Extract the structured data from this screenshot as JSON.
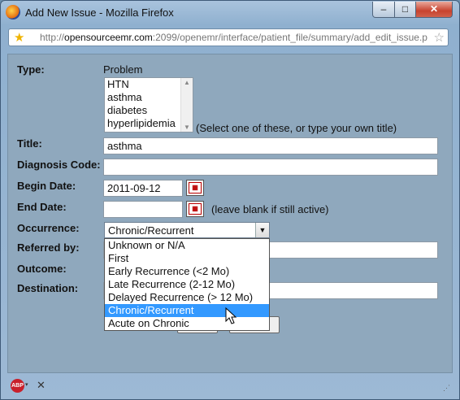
{
  "window": {
    "title": "Add New Issue - Mozilla Firefox",
    "buttons": {
      "minimize": "–",
      "maximize": "□",
      "close": "✕"
    }
  },
  "urlbar": {
    "prefix": "http://",
    "host": "opensourceemr.com",
    "rest": ":2099/openemr/interface/patient_file/summary/add_edit_issue.p"
  },
  "form": {
    "type_label": "Type:",
    "type_value": "Problem",
    "type_list": [
      "HTN",
      "asthma",
      "diabetes",
      "hyperlipidemia"
    ],
    "type_hint": "(Select one of these, or type your own title)",
    "title_label": "Title:",
    "title_value": "asthma",
    "diagnosis_label": "Diagnosis Code:",
    "diagnosis_value": "",
    "begin_label": "Begin Date:",
    "begin_value": "2011-09-12",
    "end_label": "End Date:",
    "end_value": "",
    "end_hint": "(leave blank if still active)",
    "occurrence_label": "Occurrence:",
    "occurrence_value": "Chronic/Recurrent",
    "occurrence_options": [
      "Unknown or N/A",
      "First",
      "Early Recurrence (<2 Mo)",
      "Late Recurrence (2-12 Mo)",
      "Delayed Recurrence (> 12 Mo)",
      "Chronic/Recurrent",
      "Acute on Chronic"
    ],
    "occurrence_selected_index": 5,
    "referred_label": "Referred by:",
    "outcome_label": "Outcome:",
    "destination_label": "Destination:"
  },
  "statusbar": {
    "abp_label": "ABP",
    "caret": "▾",
    "close": "✕"
  }
}
